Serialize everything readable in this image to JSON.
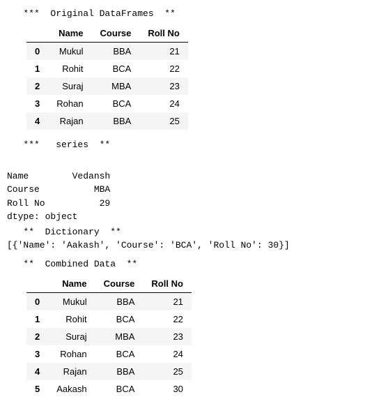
{
  "heading_original": "   ***  Original DataFrames  **",
  "heading_series": "   ***   series  **",
  "heading_dict": "   **  Dictionary  **",
  "heading_combined": "   **  Combined Data  **",
  "table1": {
    "columns": [
      "Name",
      "Course",
      "Roll No"
    ],
    "rows": [
      {
        "idx": "0",
        "c0": "Mukul",
        "c1": "BBA",
        "c2": "21"
      },
      {
        "idx": "1",
        "c0": "Rohit",
        "c1": "BCA",
        "c2": "22"
      },
      {
        "idx": "2",
        "c0": "Suraj",
        "c1": "MBA",
        "c2": "23"
      },
      {
        "idx": "3",
        "c0": "Rohan",
        "c1": "BCA",
        "c2": "24"
      },
      {
        "idx": "4",
        "c0": "Rajan",
        "c1": "BBA",
        "c2": "25"
      }
    ]
  },
  "series": {
    "line0": "Name        Vedansh",
    "line1": "Course          MBA",
    "line2": "Roll No          29",
    "dtype": "dtype: object"
  },
  "dict_repr": "[{'Name': 'Aakash', 'Course': 'BCA', 'Roll No': 30}]",
  "table2": {
    "columns": [
      "Name",
      "Course",
      "Roll No"
    ],
    "rows": [
      {
        "idx": "0",
        "c0": "Mukul",
        "c1": "BBA",
        "c2": "21"
      },
      {
        "idx": "1",
        "c0": "Rohit",
        "c1": "BCA",
        "c2": "22"
      },
      {
        "idx": "2",
        "c0": "Suraj",
        "c1": "MBA",
        "c2": "23"
      },
      {
        "idx": "3",
        "c0": "Rohan",
        "c1": "BCA",
        "c2": "24"
      },
      {
        "idx": "4",
        "c0": "Rajan",
        "c1": "BBA",
        "c2": "25"
      },
      {
        "idx": "5",
        "c0": "Aakash",
        "c1": "BCA",
        "c2": "30"
      }
    ]
  }
}
